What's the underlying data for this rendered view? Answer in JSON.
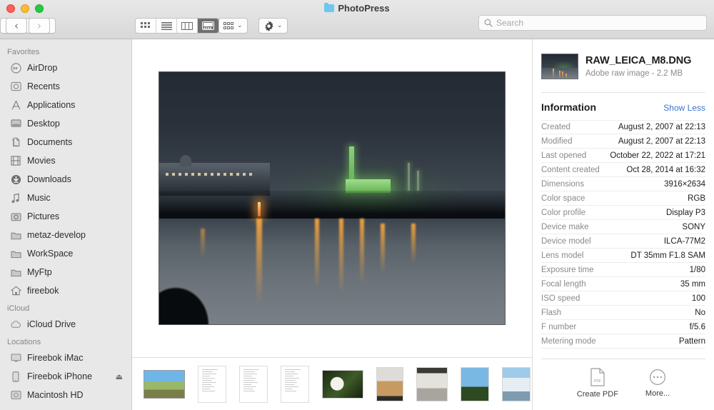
{
  "window": {
    "title": "PhotoPress",
    "title_icon": "folder-icon",
    "traffic_lights": [
      "close-red",
      "minimize-yellow",
      "zoom-green"
    ]
  },
  "toolbar": {
    "back_label": "‹",
    "forward_label": "›",
    "view_modes": [
      {
        "name": "icon-view",
        "icon": "grid-icon",
        "active": false
      },
      {
        "name": "list-view",
        "icon": "list-icon",
        "active": false
      },
      {
        "name": "column-view",
        "icon": "columns-icon",
        "active": false
      },
      {
        "name": "gallery-view",
        "icon": "gallery-icon",
        "active": true
      }
    ],
    "arrange": {
      "icon": "group-icon",
      "caret": "⌄"
    },
    "action": {
      "icon": "gear-icon",
      "caret": "⌄"
    },
    "share": {
      "icon": "share-icon"
    },
    "tag": {
      "icon": "tag-icon"
    }
  },
  "search": {
    "placeholder": "Search",
    "value": "",
    "icon": "search-icon"
  },
  "sidebar": {
    "sections": [
      {
        "title": "Favorites",
        "items": [
          {
            "label": "AirDrop",
            "icon": "airdrop-icon"
          },
          {
            "label": "Recents",
            "icon": "clock-icon"
          },
          {
            "label": "Applications",
            "icon": "applications-icon"
          },
          {
            "label": "Desktop",
            "icon": "desktop-icon"
          },
          {
            "label": "Documents",
            "icon": "documents-icon"
          },
          {
            "label": "Movies",
            "icon": "movies-icon"
          },
          {
            "label": "Downloads",
            "icon": "downloads-icon"
          },
          {
            "label": "Music",
            "icon": "music-icon"
          },
          {
            "label": "Pictures",
            "icon": "pictures-icon"
          },
          {
            "label": "metaz-develop",
            "icon": "folder-icon"
          },
          {
            "label": "WorkSpace",
            "icon": "folder-icon"
          },
          {
            "label": "MyFtp",
            "icon": "folder-icon"
          },
          {
            "label": "fireebok",
            "icon": "home-icon"
          }
        ]
      },
      {
        "title": "iCloud",
        "items": [
          {
            "label": "iCloud Drive",
            "icon": "cloud-icon"
          }
        ]
      },
      {
        "title": "Locations",
        "items": [
          {
            "label": "Fireebok iMac",
            "icon": "imac-icon"
          },
          {
            "label": "Fireebok iPhone",
            "icon": "iphone-icon",
            "eject": "⏏"
          },
          {
            "label": "Macintosh HD",
            "icon": "harddisk-icon"
          }
        ]
      }
    ]
  },
  "preview": {
    "alt": "night river city skyline with green illuminated power plant and orange light reflections"
  },
  "thumbnails": [
    {
      "name": "landscape-photo",
      "type": "photo",
      "selected": true
    },
    {
      "name": "text-document-1",
      "type": "document",
      "selected": false
    },
    {
      "name": "text-document-2",
      "type": "document",
      "selected": false
    },
    {
      "name": "text-document-3",
      "type": "document",
      "selected": false
    },
    {
      "name": "cockatoo-photo",
      "type": "photo",
      "selected": false
    },
    {
      "name": "dog-floor-photo",
      "type": "photo",
      "selected": false
    },
    {
      "name": "room-interior-photo",
      "type": "photo",
      "selected": false
    },
    {
      "name": "sky-trees-photo-1",
      "type": "photo",
      "selected": false
    },
    {
      "name": "sky-clouds-photo-2",
      "type": "photo",
      "selected": false
    }
  ],
  "info": {
    "file_name": "RAW_LEICA_M8.DNG",
    "file_subtitle": "Adobe raw image - 2.2 MB",
    "section_title": "Information",
    "toggle_label": "Show Less",
    "toggle_color": "#3b74d6",
    "rows": [
      {
        "key": "Created",
        "value": "August 2, 2007 at 22:13"
      },
      {
        "key": "Modified",
        "value": "August 2, 2007 at 22:13"
      },
      {
        "key": "Last opened",
        "value": "October 22, 2022 at 17:21"
      },
      {
        "key": "Content created",
        "value": "Oct 28, 2014 at 16:32"
      },
      {
        "key": "Dimensions",
        "value": "3916×2634"
      },
      {
        "key": "Color space",
        "value": "RGB"
      },
      {
        "key": "Color profile",
        "value": "Display P3"
      },
      {
        "key": "Device make",
        "value": "SONY"
      },
      {
        "key": "Device model",
        "value": "ILCA-77M2"
      },
      {
        "key": "Lens model",
        "value": "DT 35mm F1.8 SAM"
      },
      {
        "key": "Exposure time",
        "value": "1/80"
      },
      {
        "key": "Focal length",
        "value": "35 mm"
      },
      {
        "key": "ISO speed",
        "value": "100"
      },
      {
        "key": "Flash",
        "value": "No"
      },
      {
        "key": "F number",
        "value": "f/5.6"
      },
      {
        "key": "Metering mode",
        "value": "Pattern"
      }
    ],
    "actions": [
      {
        "label": "Create PDF",
        "icon": "pdf-document-icon"
      },
      {
        "label": "More...",
        "icon": "ellipsis-circle-icon"
      }
    ]
  }
}
